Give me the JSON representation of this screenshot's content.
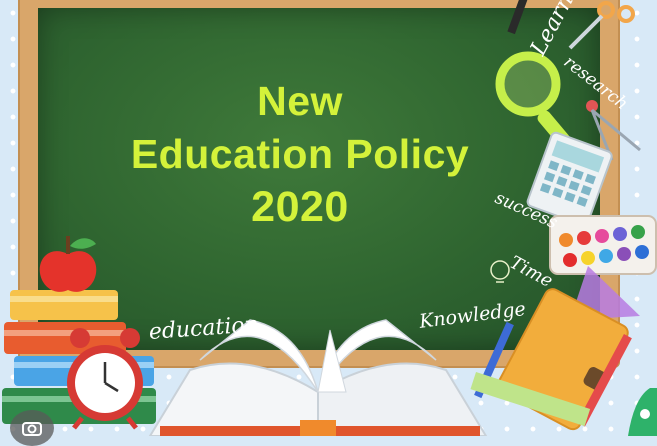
{
  "poster": {
    "title_line1": "New",
    "title_line2": "Education Policy",
    "title_line3": "2020",
    "title_color": "#d4f23a",
    "board_color": "#2f6530",
    "frame_color": "#d9a66a"
  },
  "words": {
    "learn": "Learn",
    "research": "research",
    "success": "success",
    "time": "Time",
    "knowledge": "Knowledge",
    "education": "education"
  },
  "icons": [
    "apple-icon",
    "books-icon",
    "alarm-clock-icon",
    "open-book-icon",
    "magnifier-icon",
    "calculator-icon",
    "paint-palette-icon",
    "notebook-icon",
    "pencil-icon",
    "ruler-icon",
    "compass-icon",
    "scissors-icon",
    "camera-icon",
    "lightbulb-icon"
  ]
}
